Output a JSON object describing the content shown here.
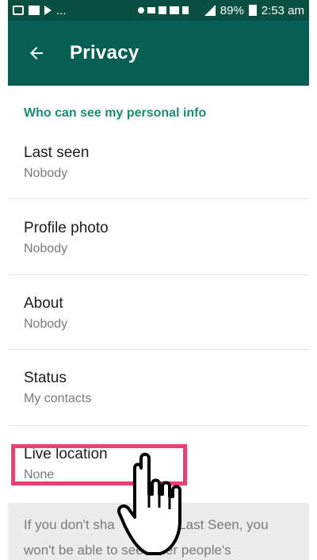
{
  "status_bar": {
    "left_icons": [
      "picture-icon",
      "mail-icon",
      "play-icon"
    ],
    "ellipsis": "...",
    "battery_percent": "89%",
    "time": "2:53 am"
  },
  "app_bar": {
    "title": "Privacy",
    "back_icon": "arrow-left-icon"
  },
  "section": {
    "header": "Who can see my personal info"
  },
  "items": [
    {
      "label": "Last seen",
      "value": "Nobody"
    },
    {
      "label": "Profile photo",
      "value": "Nobody"
    },
    {
      "label": "About",
      "value": "Nobody"
    },
    {
      "label": "Status",
      "value": "My contacts"
    },
    {
      "label": "Live location",
      "value": "None"
    }
  ],
  "footer": {
    "text_line1": "If you don't sha",
    "text_line1_end": "r Last Seen, you",
    "text_line2": "won't be able to see other people's"
  },
  "colors": {
    "status_bar": "#0b4f43",
    "app_bar": "#075e54",
    "accent": "#1d8a74",
    "highlight": "#ec3f74"
  }
}
